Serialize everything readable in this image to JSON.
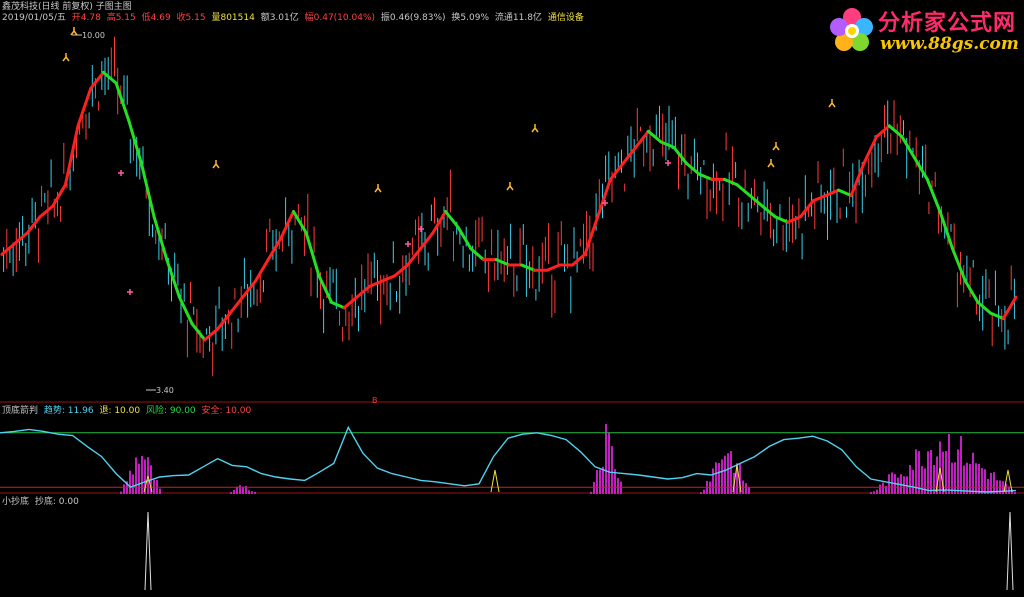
{
  "header": {
    "title": "鑫茂科技(日线 前复权) 子图主图",
    "date": "2019/01/05/五",
    "open": "开4.78",
    "high": "高5.15",
    "low": "低4.69",
    "close": "收5.15",
    "volume": "量801514",
    "amount": "额3.01亿",
    "change": "幅0.47(10.04%)",
    "amplitude": "振0.46(9.83%)",
    "turnover": "换5.09%",
    "float": "流通11.8亿",
    "sector": "通信设备"
  },
  "logo": {
    "text": "分析家公式网",
    "url": "www.88gs.com"
  },
  "panel2": {
    "name": "顶底箭判",
    "trend": "趋势: 11.96",
    "back": "退: 10.00",
    "risk": "风险: 90.00",
    "safe": "安全: 10.00"
  },
  "panel3": {
    "name": "小抄底",
    "buy": "抄底: 0.00"
  },
  "marks": {
    "high_label": "10.00",
    "low_label": "3.40",
    "b_label": "B"
  },
  "colors": {
    "up": "#ff3b3b",
    "down": "#3ad0e8",
    "ma_up": "#ff2020",
    "ma_down": "#22e022",
    "trend": "#4fd2f0",
    "risk": "#22bb44",
    "safe": "#d02020",
    "bars": "#c020c0",
    "yellow": "#f0e040"
  },
  "chart_data": [
    {
      "type": "line",
      "title": "",
      "note": "main price panel; values are approximate price levels",
      "y_range": [
        3.4,
        10.0
      ],
      "series": [
        {
          "values": [
            5.9,
            6.1,
            6.3,
            6.6,
            6.8,
            7.2,
            8.3,
            9.0,
            9.3,
            9.1,
            8.4,
            7.6,
            6.6,
            5.8,
            5.1,
            4.6,
            4.3,
            4.5,
            4.8,
            5.1,
            5.4,
            5.8,
            6.2,
            6.7,
            6.3,
            5.5,
            5.0,
            4.9,
            5.1,
            5.3,
            5.4,
            5.5,
            5.7,
            6.0,
            6.3,
            6.7,
            6.4,
            6.0,
            5.8,
            5.8,
            5.7,
            5.7,
            5.6,
            5.6,
            5.7,
            5.7,
            5.9,
            6.6,
            7.3,
            7.6,
            7.9,
            8.2,
            8.0,
            7.9,
            7.6,
            7.4,
            7.3,
            7.3,
            7.2,
            7.0,
            6.8,
            6.6,
            6.5,
            6.6,
            6.9,
            7.0,
            7.1,
            7.0,
            7.6,
            8.1,
            8.3,
            8.1,
            7.7,
            7.3,
            6.7,
            6.0,
            5.4,
            5.0,
            4.8,
            4.7,
            5.1
          ]
        }
      ]
    },
    {
      "type": "line",
      "title": "",
      "y_range": [
        0,
        100
      ],
      "series": [
        {
          "name": "趋势",
          "values": [
            90,
            92,
            95,
            92,
            88,
            86,
            70,
            55,
            30,
            10,
            18,
            25,
            27,
            28,
            40,
            52,
            42,
            40,
            30,
            25,
            22,
            20,
            32,
            45,
            98,
            60,
            38,
            30,
            25,
            20,
            18,
            15,
            12,
            15,
            55,
            82,
            88,
            90,
            86,
            80,
            62,
            40,
            32,
            30,
            28,
            25,
            22,
            24,
            30,
            28,
            35,
            45,
            55,
            70,
            80,
            82,
            85,
            78,
            65,
            40,
            22,
            18,
            14,
            10,
            5,
            6,
            5,
            4,
            3,
            4,
            5
          ]
        }
      ],
      "risk_level": 90,
      "safe_level": 10
    },
    {
      "type": "bar",
      "title": "",
      "series": [
        {
          "name": "抄底",
          "values": [
            1,
            1
          ]
        }
      ]
    }
  ]
}
